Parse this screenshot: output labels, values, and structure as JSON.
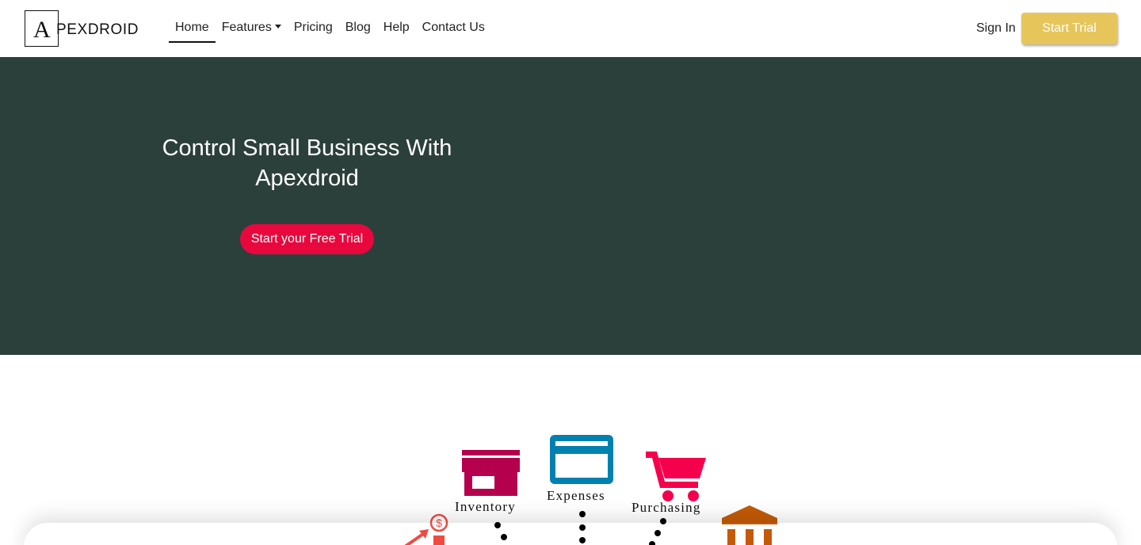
{
  "brand": {
    "logo_initial": "A",
    "logo_rest": "PEXDROID"
  },
  "nav": {
    "items": [
      {
        "label": "Home"
      },
      {
        "label": "Features"
      },
      {
        "label": "Pricing"
      },
      {
        "label": "Blog"
      },
      {
        "label": "Help"
      },
      {
        "label": "Contact Us"
      }
    ],
    "sign_in": "Sign In",
    "start_trial": "Start Trial"
  },
  "hero": {
    "title": "Control Small Business With Apexdroid",
    "cta": "Start your Free Trial"
  },
  "features": {
    "inventory": "Inventory",
    "expenses": "Expenses",
    "purchasing": "Purchasing"
  },
  "colors": {
    "hero_bg": "#2c403b",
    "cta_red": "#e8083e",
    "trial_gold": "#e6c55a",
    "inventory": "#b5004e",
    "expenses": "#0081b0",
    "purchasing": "#f5004d",
    "bank": "#c45a07",
    "sales": "#f04a43"
  },
  "icons": [
    "store-icon",
    "credit-card-icon",
    "shopping-cart-icon",
    "bank-icon",
    "sales-dollar-icon"
  ]
}
